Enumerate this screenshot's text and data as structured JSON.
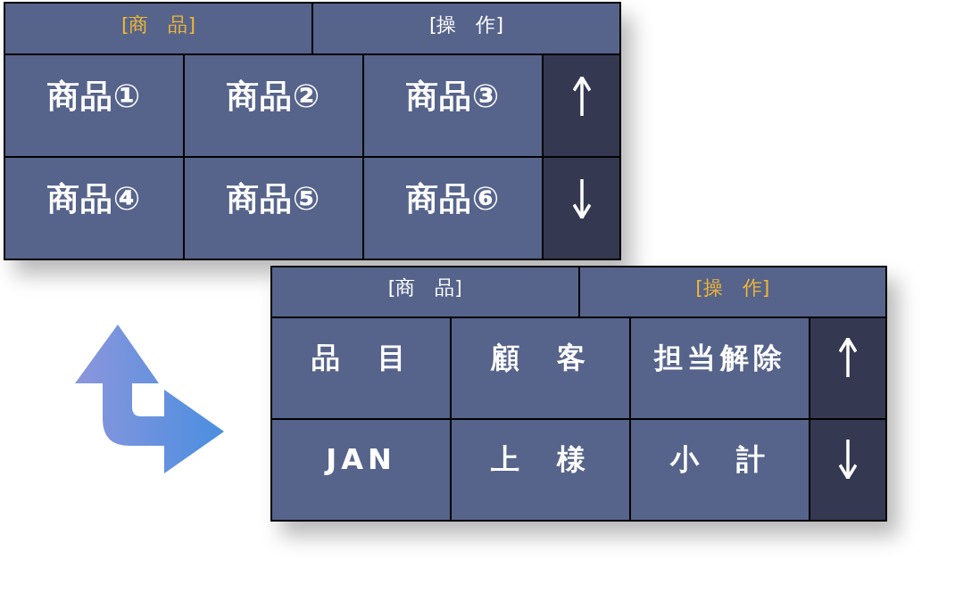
{
  "panels": [
    {
      "tabs": [
        {
          "label": "[商　品]",
          "selected": true
        },
        {
          "label": "[操　作]",
          "selected": false
        }
      ],
      "buttons": [
        "商品①",
        "商品②",
        "商品③",
        "商品④",
        "商品⑤",
        "商品⑥"
      ]
    },
    {
      "tabs": [
        {
          "label": "[商　品]",
          "selected": false
        },
        {
          "label": "[操　作]",
          "selected": true
        }
      ],
      "buttons": [
        "品　目",
        "顧　客",
        "担当解除",
        "JAN",
        "上　様",
        "小　計"
      ]
    }
  ]
}
